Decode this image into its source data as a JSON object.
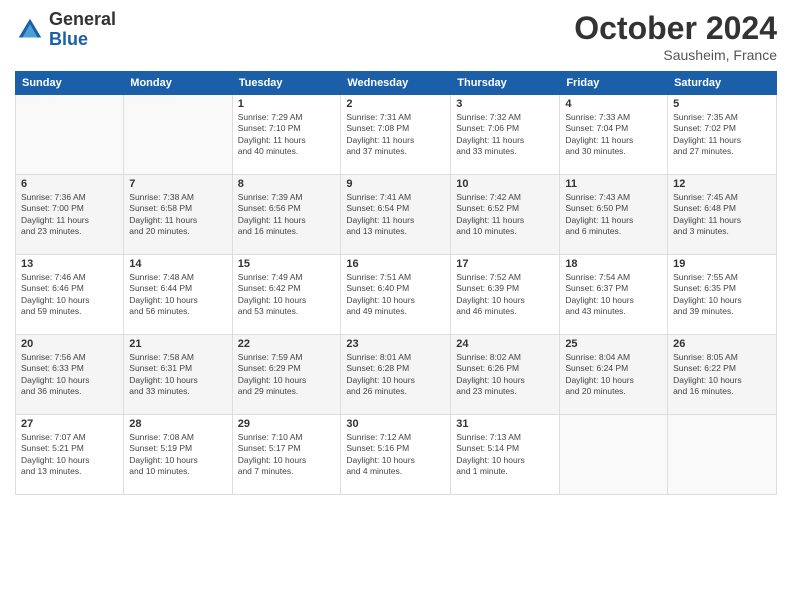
{
  "logo": {
    "general": "General",
    "blue": "Blue"
  },
  "header": {
    "month": "October 2024",
    "location": "Sausheim, France"
  },
  "days_of_week": [
    "Sunday",
    "Monday",
    "Tuesday",
    "Wednesday",
    "Thursday",
    "Friday",
    "Saturday"
  ],
  "weeks": [
    [
      {
        "day": "",
        "info": ""
      },
      {
        "day": "",
        "info": ""
      },
      {
        "day": "1",
        "info": "Sunrise: 7:29 AM\nSunset: 7:10 PM\nDaylight: 11 hours\nand 40 minutes."
      },
      {
        "day": "2",
        "info": "Sunrise: 7:31 AM\nSunset: 7:08 PM\nDaylight: 11 hours\nand 37 minutes."
      },
      {
        "day": "3",
        "info": "Sunrise: 7:32 AM\nSunset: 7:06 PM\nDaylight: 11 hours\nand 33 minutes."
      },
      {
        "day": "4",
        "info": "Sunrise: 7:33 AM\nSunset: 7:04 PM\nDaylight: 11 hours\nand 30 minutes."
      },
      {
        "day": "5",
        "info": "Sunrise: 7:35 AM\nSunset: 7:02 PM\nDaylight: 11 hours\nand 27 minutes."
      }
    ],
    [
      {
        "day": "6",
        "info": "Sunrise: 7:36 AM\nSunset: 7:00 PM\nDaylight: 11 hours\nand 23 minutes."
      },
      {
        "day": "7",
        "info": "Sunrise: 7:38 AM\nSunset: 6:58 PM\nDaylight: 11 hours\nand 20 minutes."
      },
      {
        "day": "8",
        "info": "Sunrise: 7:39 AM\nSunset: 6:56 PM\nDaylight: 11 hours\nand 16 minutes."
      },
      {
        "day": "9",
        "info": "Sunrise: 7:41 AM\nSunset: 6:54 PM\nDaylight: 11 hours\nand 13 minutes."
      },
      {
        "day": "10",
        "info": "Sunrise: 7:42 AM\nSunset: 6:52 PM\nDaylight: 11 hours\nand 10 minutes."
      },
      {
        "day": "11",
        "info": "Sunrise: 7:43 AM\nSunset: 6:50 PM\nDaylight: 11 hours\nand 6 minutes."
      },
      {
        "day": "12",
        "info": "Sunrise: 7:45 AM\nSunset: 6:48 PM\nDaylight: 11 hours\nand 3 minutes."
      }
    ],
    [
      {
        "day": "13",
        "info": "Sunrise: 7:46 AM\nSunset: 6:46 PM\nDaylight: 10 hours\nand 59 minutes."
      },
      {
        "day": "14",
        "info": "Sunrise: 7:48 AM\nSunset: 6:44 PM\nDaylight: 10 hours\nand 56 minutes."
      },
      {
        "day": "15",
        "info": "Sunrise: 7:49 AM\nSunset: 6:42 PM\nDaylight: 10 hours\nand 53 minutes."
      },
      {
        "day": "16",
        "info": "Sunrise: 7:51 AM\nSunset: 6:40 PM\nDaylight: 10 hours\nand 49 minutes."
      },
      {
        "day": "17",
        "info": "Sunrise: 7:52 AM\nSunset: 6:39 PM\nDaylight: 10 hours\nand 46 minutes."
      },
      {
        "day": "18",
        "info": "Sunrise: 7:54 AM\nSunset: 6:37 PM\nDaylight: 10 hours\nand 43 minutes."
      },
      {
        "day": "19",
        "info": "Sunrise: 7:55 AM\nSunset: 6:35 PM\nDaylight: 10 hours\nand 39 minutes."
      }
    ],
    [
      {
        "day": "20",
        "info": "Sunrise: 7:56 AM\nSunset: 6:33 PM\nDaylight: 10 hours\nand 36 minutes."
      },
      {
        "day": "21",
        "info": "Sunrise: 7:58 AM\nSunset: 6:31 PM\nDaylight: 10 hours\nand 33 minutes."
      },
      {
        "day": "22",
        "info": "Sunrise: 7:59 AM\nSunset: 6:29 PM\nDaylight: 10 hours\nand 29 minutes."
      },
      {
        "day": "23",
        "info": "Sunrise: 8:01 AM\nSunset: 6:28 PM\nDaylight: 10 hours\nand 26 minutes."
      },
      {
        "day": "24",
        "info": "Sunrise: 8:02 AM\nSunset: 6:26 PM\nDaylight: 10 hours\nand 23 minutes."
      },
      {
        "day": "25",
        "info": "Sunrise: 8:04 AM\nSunset: 6:24 PM\nDaylight: 10 hours\nand 20 minutes."
      },
      {
        "day": "26",
        "info": "Sunrise: 8:05 AM\nSunset: 6:22 PM\nDaylight: 10 hours\nand 16 minutes."
      }
    ],
    [
      {
        "day": "27",
        "info": "Sunrise: 7:07 AM\nSunset: 5:21 PM\nDaylight: 10 hours\nand 13 minutes."
      },
      {
        "day": "28",
        "info": "Sunrise: 7:08 AM\nSunset: 5:19 PM\nDaylight: 10 hours\nand 10 minutes."
      },
      {
        "day": "29",
        "info": "Sunrise: 7:10 AM\nSunset: 5:17 PM\nDaylight: 10 hours\nand 7 minutes."
      },
      {
        "day": "30",
        "info": "Sunrise: 7:12 AM\nSunset: 5:16 PM\nDaylight: 10 hours\nand 4 minutes."
      },
      {
        "day": "31",
        "info": "Sunrise: 7:13 AM\nSunset: 5:14 PM\nDaylight: 10 hours\nand 1 minute."
      },
      {
        "day": "",
        "info": ""
      },
      {
        "day": "",
        "info": ""
      }
    ]
  ]
}
